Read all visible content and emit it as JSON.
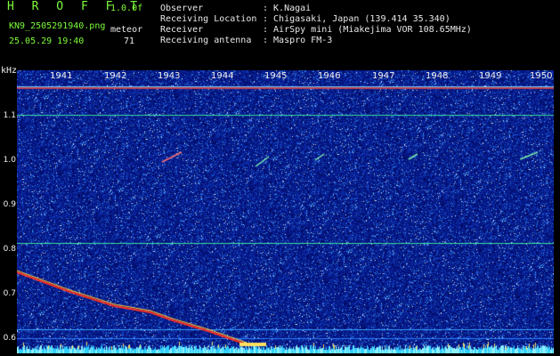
{
  "header": {
    "logo": "H R O F F T",
    "version": "1.0.0f",
    "filename": "KN9_2505291940.png",
    "datetime": "25.05.29 19:40",
    "meteor_label": "meteor",
    "meteor_count": "71",
    "info": [
      {
        "key": "Observer",
        "value": ": K.Nagai"
      },
      {
        "key": "Receiving Location",
        "value": ": Chigasaki, Japan (139.414 35.340)"
      },
      {
        "key": "Receiver",
        "value": ": AirSpy mini (Miakejima VOR 108.65MHz)"
      },
      {
        "key": "Receiving antenna",
        "value": ": Maspro FM-3"
      }
    ]
  },
  "axis": {
    "y_unit": "kHz",
    "y_ticks": [
      "1.1",
      "1.0",
      "0.9",
      "0.8",
      "0.7",
      "0.6"
    ],
    "x_ticks": [
      "1941",
      "1942",
      "1943",
      "1944",
      "1945",
      "1946",
      "1947",
      "1948",
      "1949",
      "1950"
    ]
  },
  "colors": {
    "background": "#000000",
    "label_green": "#7cfc3a",
    "spectrogram_base": "#061a8c",
    "carrier_line": "#38d27a",
    "hot_line": "#ff3020"
  }
}
